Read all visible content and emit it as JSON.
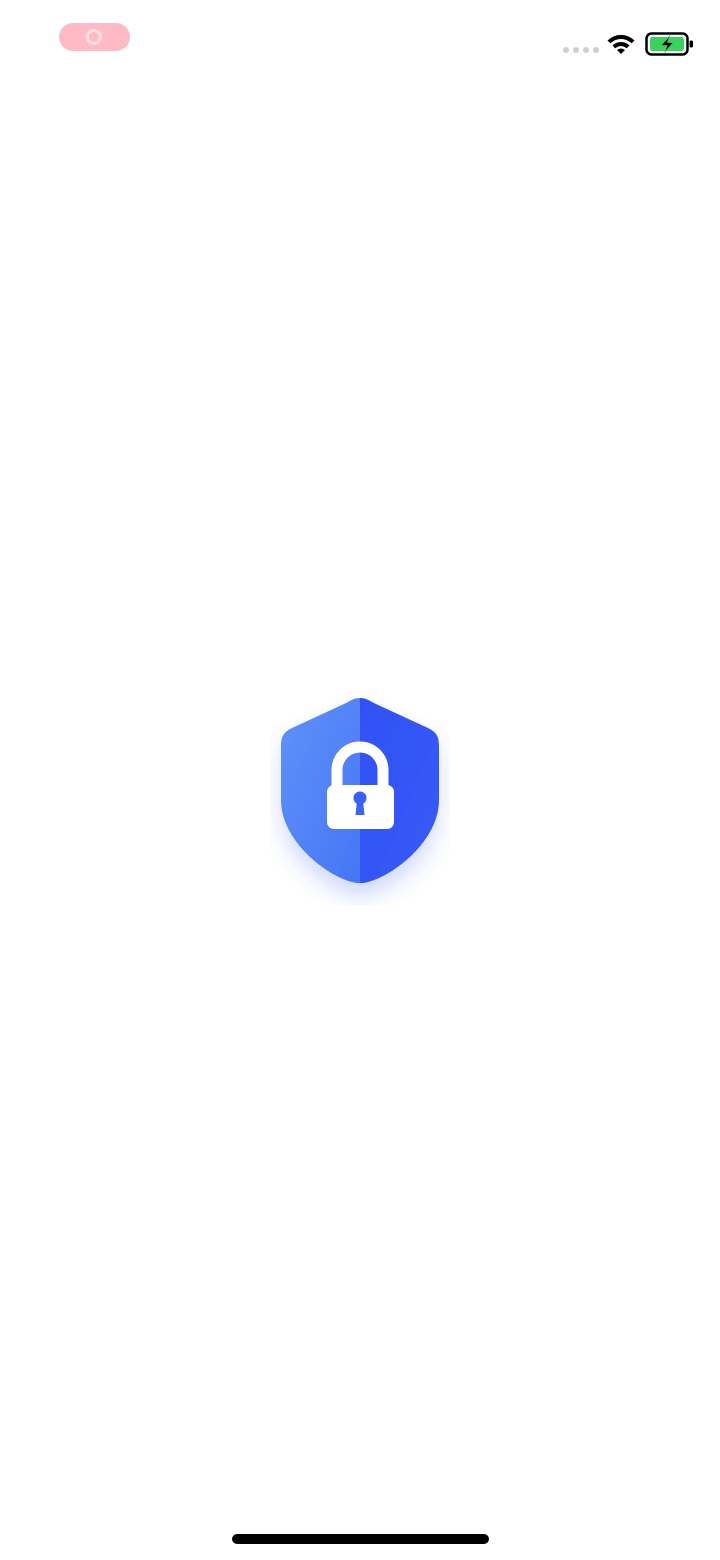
{
  "status_bar": {
    "recording_icon": "screen-recording-icon",
    "signal_icon": "signal-dots-icon",
    "wifi_icon": "wifi-icon",
    "battery_icon": "battery-charging-icon"
  },
  "splash": {
    "logo_icon": "shield-lock-icon"
  },
  "colors": {
    "background": "#ffffff",
    "recording_pill": "#ffb3bd",
    "shield_light": "#5b8ef9",
    "shield_dark": "#2f54f5",
    "lock": "#ffffff",
    "battery_fill": "#3bd15d",
    "status_icons": "#000000",
    "home_indicator": "#000000"
  }
}
